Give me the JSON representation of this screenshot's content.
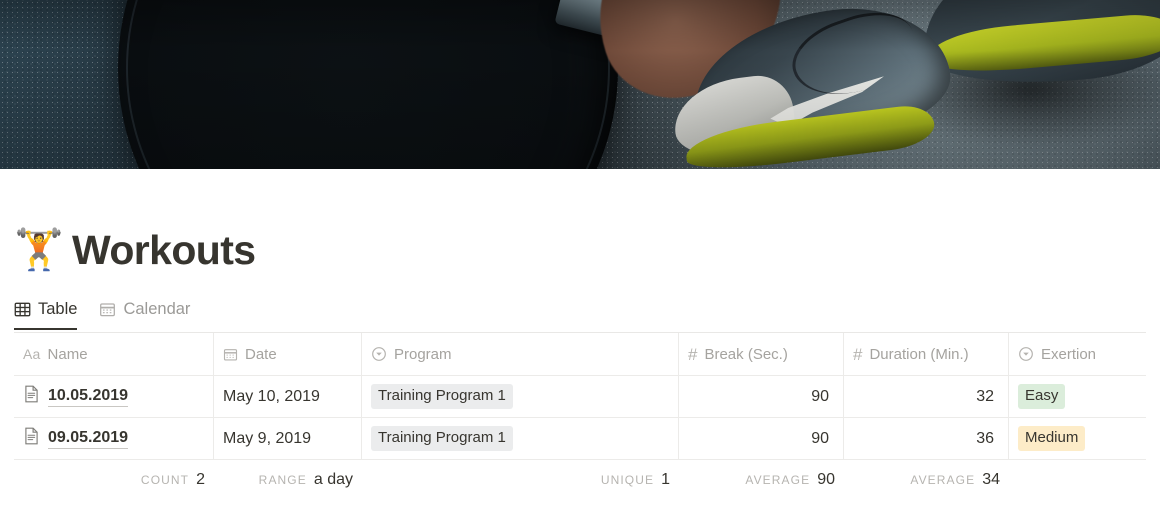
{
  "cover": {
    "alt": "barbell-and-sneakers-on-asphalt-photo",
    "dominant_colors": [
      "#24333c",
      "#0a0e11",
      "#8fa2ab",
      "#c9d622"
    ]
  },
  "page": {
    "emoji": "🏋️",
    "emoji_name": "weight-lifter-emoji",
    "title": "Workouts"
  },
  "tabs": [
    {
      "label": "Table",
      "icon": "table-icon",
      "active": true
    },
    {
      "label": "Calendar",
      "icon": "calendar-icon",
      "active": false
    }
  ],
  "table": {
    "columns": [
      {
        "label": "Name",
        "icon": "aa-text-icon",
        "type": "title",
        "align": "left"
      },
      {
        "label": "Date",
        "icon": "calendar-icon",
        "type": "date",
        "align": "left"
      },
      {
        "label": "Program",
        "icon": "select-icon",
        "type": "select",
        "align": "left"
      },
      {
        "label": "Break (Sec.)",
        "icon": "hash-number-icon",
        "type": "number",
        "align": "right"
      },
      {
        "label": "Duration (Min.)",
        "icon": "hash-number-icon",
        "type": "number",
        "align": "right"
      },
      {
        "label": "Exertion",
        "icon": "select-icon",
        "type": "select",
        "align": "left"
      }
    ],
    "rows": [
      {
        "icon": "page-document-icon",
        "name": "10.05.2019",
        "date": "May 10, 2019",
        "program": "Training Program 1",
        "break_sec": "90",
        "duration_min": "32",
        "exertion": "Easy",
        "exertion_color": "#dbeddb"
      },
      {
        "icon": "page-document-icon",
        "name": "09.05.2019",
        "date": "May 9, 2019",
        "program": "Training Program 1",
        "break_sec": "90",
        "duration_min": "36",
        "exertion": "Medium",
        "exertion_color": "#fdecc8"
      }
    ],
    "summary": [
      {
        "label": "COUNT",
        "value": "2"
      },
      {
        "label": "RANGE",
        "value": "a day"
      },
      {
        "label": "",
        "value": ""
      },
      {
        "label": "UNIQUE",
        "value": "1"
      },
      {
        "label": "AVERAGE",
        "value": "90"
      },
      {
        "label": "AVERAGE",
        "value": "34"
      }
    ]
  },
  "colors": {
    "text": "#37352f",
    "muted": "#9b9a97",
    "border": "#ecebe9",
    "tag_default": "#ebeced",
    "tag_green": "#dbeddb",
    "tag_yellow": "#fdecc8"
  }
}
